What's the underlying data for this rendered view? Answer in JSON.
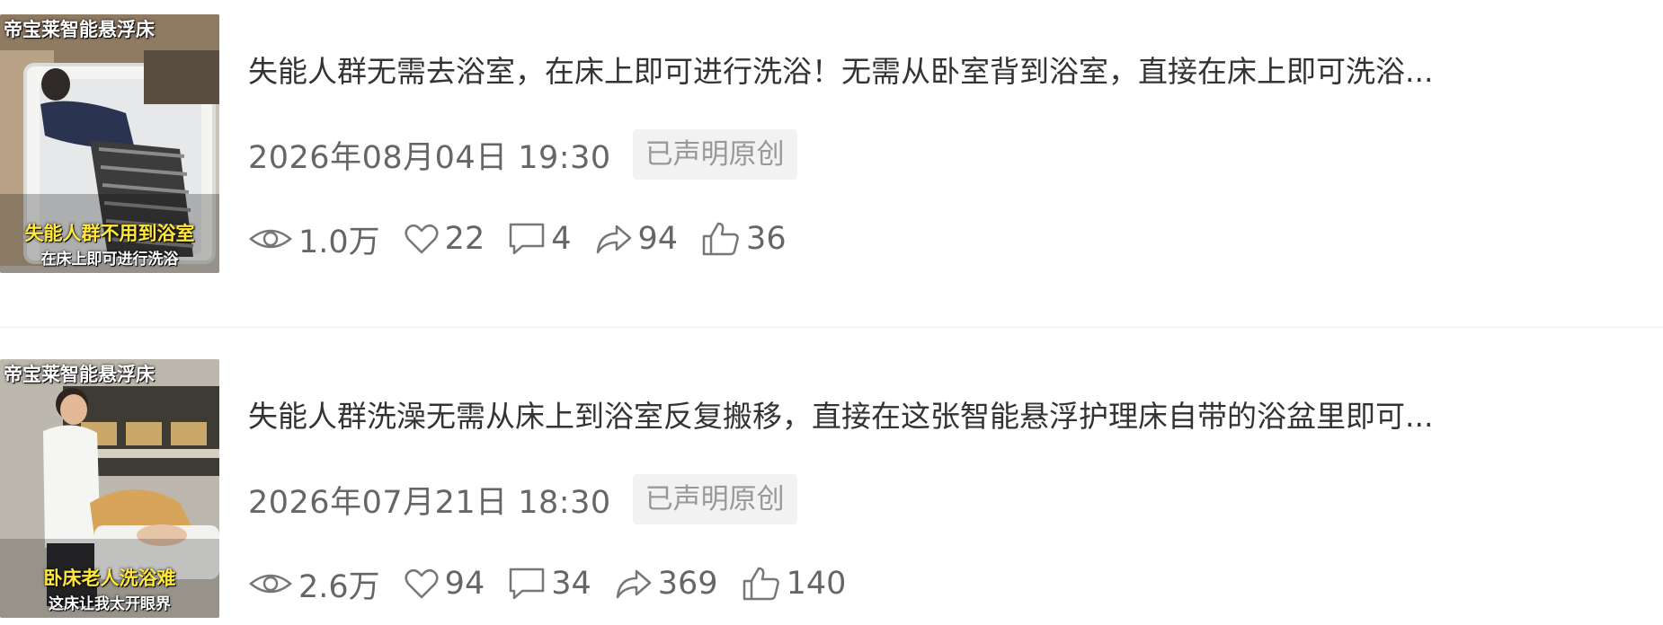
{
  "posts": [
    {
      "thumbnail": {
        "banner": "帝宝莱智能悬浮床",
        "caption_top": "失能人群不用到浴室",
        "caption_bottom": "在床上即可进行洗浴"
      },
      "title": "失能人群无需去浴室，在床上即可进行洗浴！无需从卧室背到浴室，直接在床上即可洗浴...",
      "date": "2026年08月04日 19:30",
      "badge": "已声明原创",
      "stats": {
        "views": "1.0万",
        "likes": "22",
        "comments": "4",
        "shares": "94",
        "thumbs": "36"
      }
    },
    {
      "thumbnail": {
        "banner": "帝宝莱智能悬浮床",
        "caption_top": "卧床老人洗浴难",
        "caption_bottom": "这床让我太开眼界"
      },
      "title": "失能人群洗澡无需从床上到浴室反复搬移，直接在这张智能悬浮护理床自带的浴盆里即可...",
      "date": "2026年07月21日 18:30",
      "badge": "已声明原创",
      "stats": {
        "views": "2.6万",
        "likes": "94",
        "comments": "34",
        "shares": "369",
        "thumbs": "140"
      }
    }
  ],
  "icons": {
    "views": "eye-icon",
    "likes": "heart-icon",
    "comments": "comment-icon",
    "shares": "share-icon",
    "thumbs": "thumbs-up-icon"
  },
  "colors": {
    "title": "#333333",
    "meta": "#666666",
    "badge_bg": "#f2f2f2",
    "badge_text": "#999999",
    "caption_yellow": "#ffe83a"
  }
}
